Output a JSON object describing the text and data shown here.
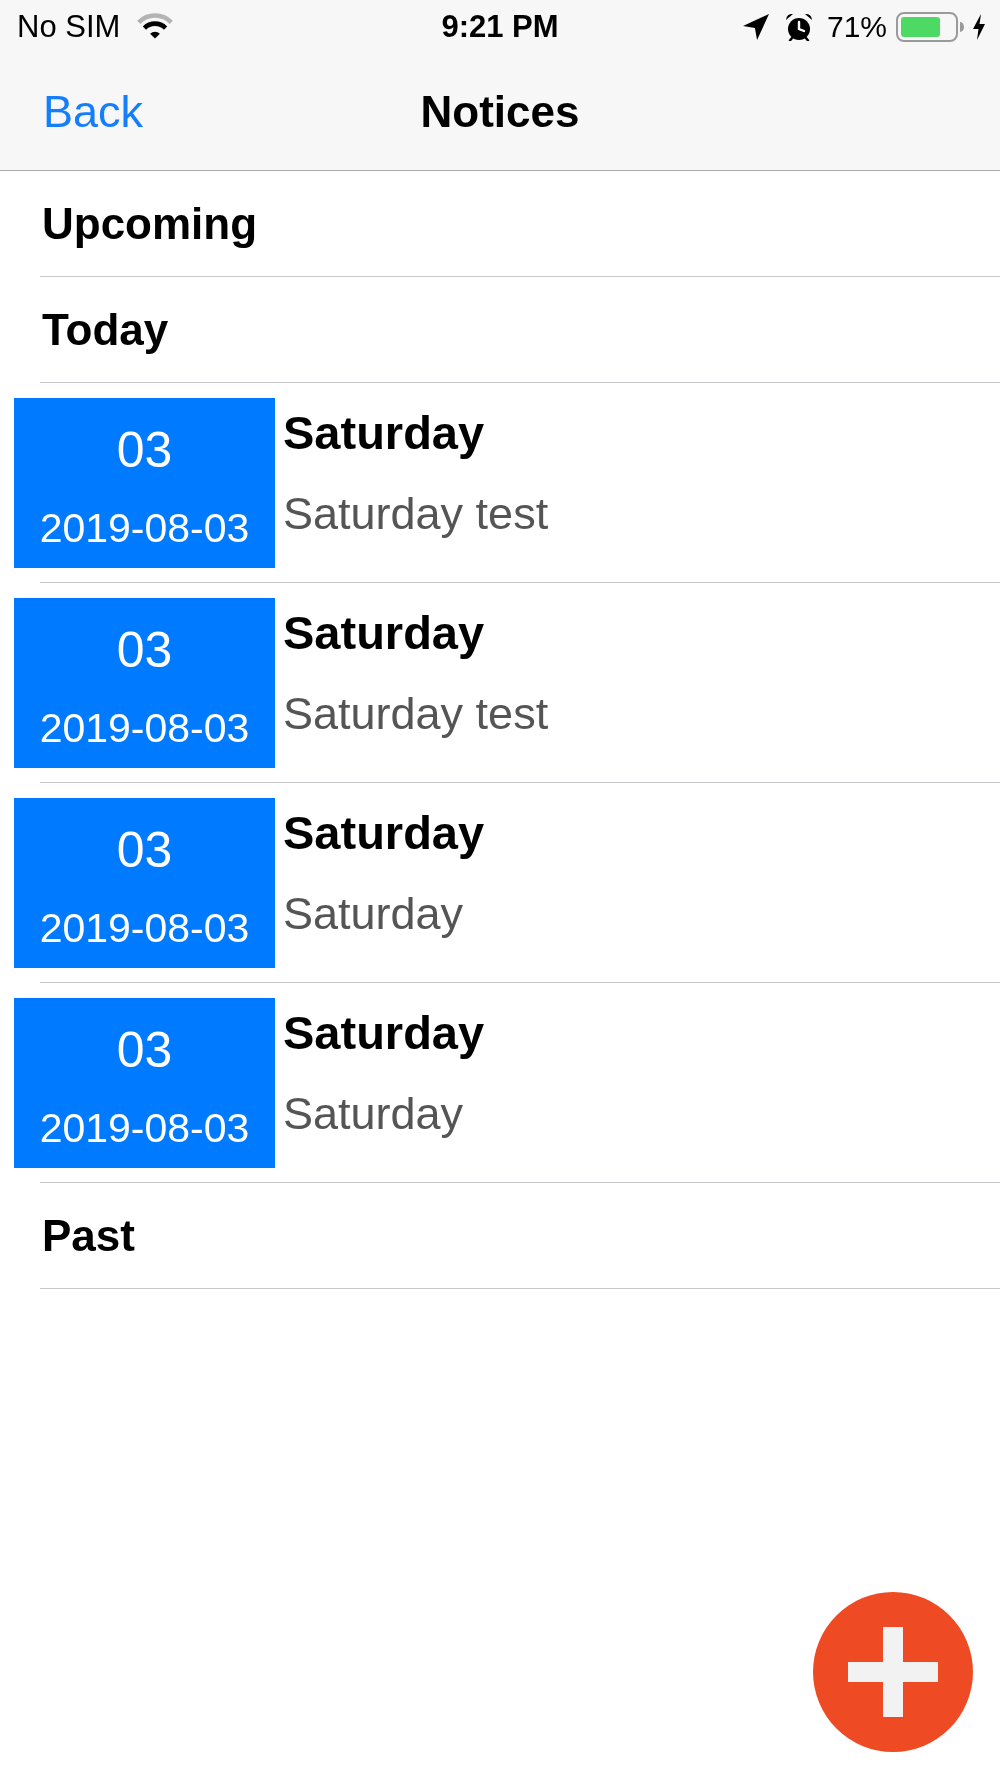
{
  "status_bar": {
    "carrier": "No SIM",
    "time": "9:21 PM",
    "battery_percent": "71%"
  },
  "nav_bar": {
    "back": "Back",
    "title": "Notices"
  },
  "sections": [
    {
      "title": "Upcoming"
    },
    {
      "title": "Today",
      "notices": [
        {
          "day": "03",
          "date": "2019-08-03",
          "title": "Saturday",
          "description": "Saturday test"
        },
        {
          "day": "03",
          "date": "2019-08-03",
          "title": "Saturday",
          "description": "Saturday test"
        },
        {
          "day": "03",
          "date": "2019-08-03",
          "title": "Saturday",
          "description": "Saturday"
        },
        {
          "day": "03",
          "date": "2019-08-03",
          "title": "Saturday",
          "description": "Saturday"
        }
      ]
    },
    {
      "title": "Past"
    }
  ]
}
